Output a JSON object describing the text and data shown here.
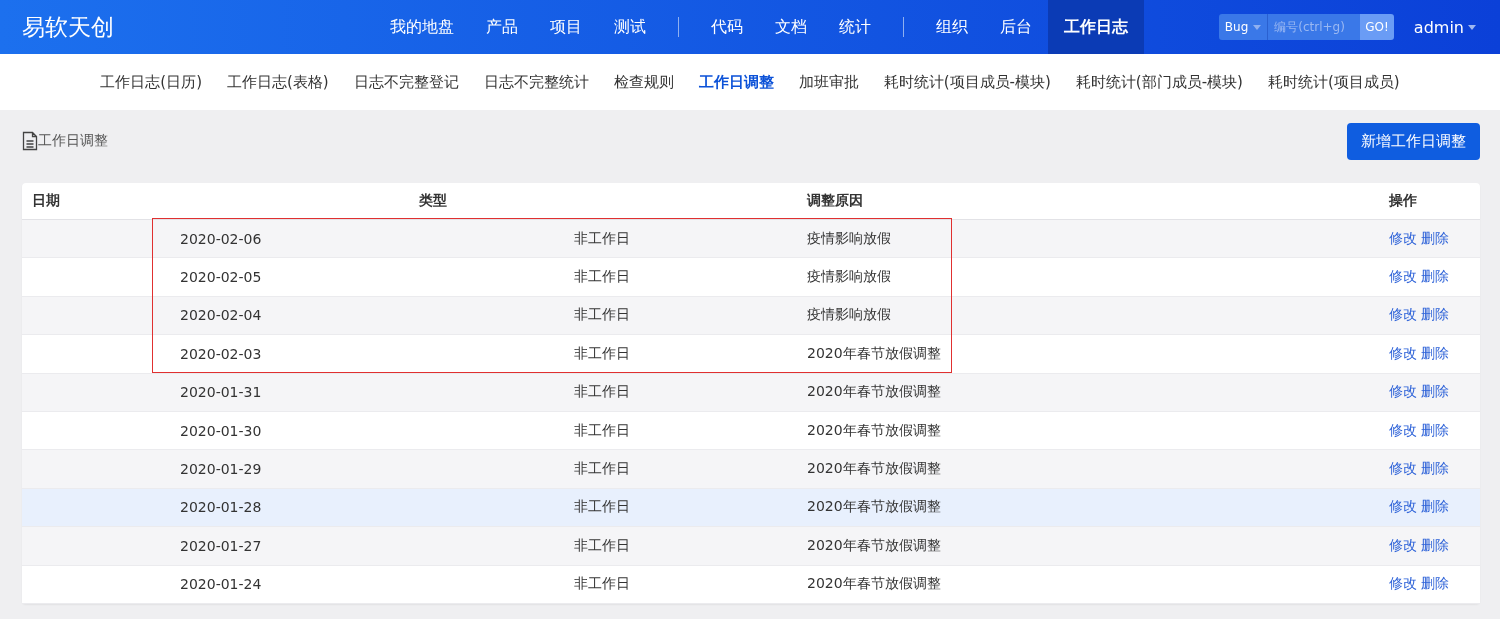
{
  "brand": "易软天创",
  "main_nav": [
    {
      "kind": "item",
      "label": "我的地盘",
      "selected": false
    },
    {
      "kind": "item",
      "label": "产品",
      "selected": false
    },
    {
      "kind": "item",
      "label": "项目",
      "selected": false
    },
    {
      "kind": "item",
      "label": "测试",
      "selected": false
    },
    {
      "kind": "divider"
    },
    {
      "kind": "item",
      "label": "代码",
      "selected": false
    },
    {
      "kind": "item",
      "label": "文档",
      "selected": false
    },
    {
      "kind": "item",
      "label": "统计",
      "selected": false
    },
    {
      "kind": "divider"
    },
    {
      "kind": "item",
      "label": "组织",
      "selected": false
    },
    {
      "kind": "item",
      "label": "后台",
      "selected": false
    },
    {
      "kind": "item",
      "label": "工作日志",
      "selected": true
    }
  ],
  "search": {
    "type": "Bug",
    "placeholder": "编号(ctrl+g)",
    "button": "GO!"
  },
  "user": "admin",
  "sub_nav": [
    {
      "label": "工作日志(日历)",
      "selected": false
    },
    {
      "label": "工作日志(表格)",
      "selected": false
    },
    {
      "label": "日志不完整登记",
      "selected": false
    },
    {
      "label": "日志不完整统计",
      "selected": false
    },
    {
      "label": "检查规则",
      "selected": false
    },
    {
      "label": "工作日调整",
      "selected": true
    },
    {
      "label": "加班审批",
      "selected": false
    },
    {
      "label": "耗时统计(项目成员-模块)",
      "selected": false
    },
    {
      "label": "耗时统计(部门成员-模块)",
      "selected": false
    },
    {
      "label": "耗时统计(项目成员)",
      "selected": false
    }
  ],
  "page_title": "工作日调整",
  "add_button": "新增工作日调整",
  "table": {
    "columns": [
      "日期",
      "类型",
      "调整原因",
      "操作"
    ],
    "rows": [
      {
        "date": "2020-02-06",
        "type": "非工作日",
        "reason": "疫情影响放假",
        "actions": [
          "修改",
          "删除"
        ],
        "highlighted": true,
        "hovered": false
      },
      {
        "date": "2020-02-05",
        "type": "非工作日",
        "reason": "疫情影响放假",
        "actions": [
          "修改",
          "删除"
        ],
        "highlighted": true,
        "hovered": false
      },
      {
        "date": "2020-02-04",
        "type": "非工作日",
        "reason": "疫情影响放假",
        "actions": [
          "修改",
          "删除"
        ],
        "highlighted": true,
        "hovered": false
      },
      {
        "date": "2020-02-03",
        "type": "非工作日",
        "reason": "2020年春节放假调整",
        "actions": [
          "修改",
          "删除"
        ],
        "highlighted": true,
        "hovered": false
      },
      {
        "date": "2020-01-31",
        "type": "非工作日",
        "reason": "2020年春节放假调整",
        "actions": [
          "修改",
          "删除"
        ],
        "highlighted": false,
        "hovered": false
      },
      {
        "date": "2020-01-30",
        "type": "非工作日",
        "reason": "2020年春节放假调整",
        "actions": [
          "修改",
          "删除"
        ],
        "highlighted": false,
        "hovered": false
      },
      {
        "date": "2020-01-29",
        "type": "非工作日",
        "reason": "2020年春节放假调整",
        "actions": [
          "修改",
          "删除"
        ],
        "highlighted": false,
        "hovered": false
      },
      {
        "date": "2020-01-28",
        "type": "非工作日",
        "reason": "2020年春节放假调整",
        "actions": [
          "修改",
          "删除"
        ],
        "highlighted": false,
        "hovered": true
      },
      {
        "date": "2020-01-27",
        "type": "非工作日",
        "reason": "2020年春节放假调整",
        "actions": [
          "修改",
          "删除"
        ],
        "highlighted": false,
        "hovered": false
      },
      {
        "date": "2020-01-24",
        "type": "非工作日",
        "reason": "2020年春节放假调整",
        "actions": [
          "修改",
          "删除"
        ],
        "highlighted": false,
        "hovered": false
      }
    ]
  }
}
